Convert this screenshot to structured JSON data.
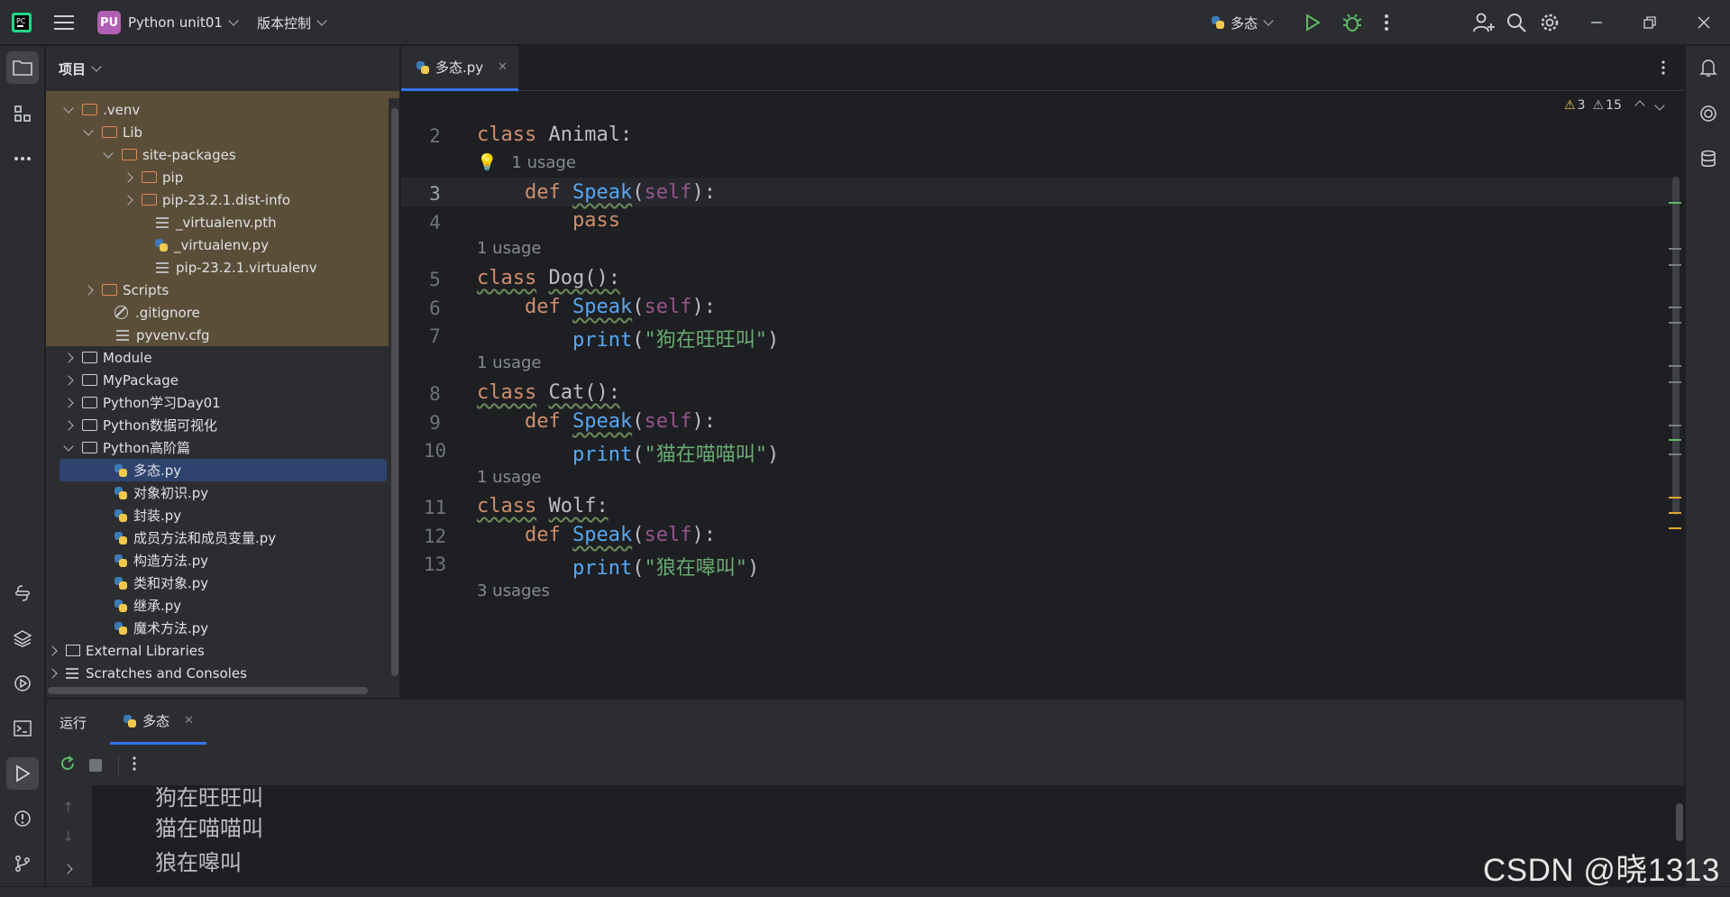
{
  "titlebar": {
    "project_badge": "PU",
    "project_name": "Python unit01",
    "vcs_label": "版本控制",
    "run_config": "多态"
  },
  "project_panel": {
    "title": "项目",
    "tree": [
      {
        "label": ".venv",
        "type": "folder-excluded",
        "state": "expanded"
      },
      {
        "label": "Lib",
        "type": "folder-excluded",
        "state": "expanded"
      },
      {
        "label": "site-packages",
        "type": "folder-excluded",
        "state": "expanded"
      },
      {
        "label": "pip",
        "type": "folder-excluded",
        "state": "collapsed"
      },
      {
        "label": "pip-23.2.1.dist-info",
        "type": "folder-excluded",
        "state": "collapsed"
      },
      {
        "label": "_virtualenv.pth",
        "type": "text"
      },
      {
        "label": "_virtualenv.py",
        "type": "python"
      },
      {
        "label": "pip-23.2.1.virtualenv",
        "type": "text"
      },
      {
        "label": "Scripts",
        "type": "folder-excluded",
        "state": "collapsed"
      },
      {
        "label": ".gitignore",
        "type": "ignore"
      },
      {
        "label": "pyvenv.cfg",
        "type": "text"
      },
      {
        "label": "Module",
        "type": "folder",
        "state": "collapsed"
      },
      {
        "label": "MyPackage",
        "type": "package",
        "state": "collapsed"
      },
      {
        "label": "Python学习Day01",
        "type": "folder",
        "state": "collapsed"
      },
      {
        "label": "Python数据可视化",
        "type": "folder",
        "state": "collapsed"
      },
      {
        "label": "Python高阶篇",
        "type": "folder",
        "state": "expanded"
      },
      {
        "label": "多态.py",
        "type": "python",
        "selected": true
      },
      {
        "label": "对象初识.py",
        "type": "python"
      },
      {
        "label": "封装.py",
        "type": "python"
      },
      {
        "label": "成员方法和成员变量.py",
        "type": "python"
      },
      {
        "label": "构造方法.py",
        "type": "python"
      },
      {
        "label": "类和对象.py",
        "type": "python"
      },
      {
        "label": "继承.py",
        "type": "python"
      },
      {
        "label": "魔术方法.py",
        "type": "python"
      },
      {
        "label": "External Libraries",
        "type": "library",
        "state": "collapsed"
      },
      {
        "label": "Scratches and Consoles",
        "type": "scratches",
        "state": "collapsed"
      }
    ]
  },
  "editor": {
    "tab_label": "多态.py",
    "warnings_a": "3",
    "warnings_b": "15",
    "line_numbers": [
      "2",
      "3",
      "4",
      "5",
      "6",
      "7",
      "8",
      "9",
      "10",
      "11",
      "12",
      "13"
    ],
    "hints": {
      "animal_usage": "1 usage",
      "dog_usage": "1 usage",
      "cat_usage": "1 usage",
      "wolf_usage": "1 usage",
      "func_usage": "3 usages"
    },
    "code": {
      "l2_kw": "class",
      "l2_name": "Animal:",
      "def": "def",
      "speak": "Speak",
      "self": "self",
      "pass": "pass",
      "print": "print",
      "l5_name": "Dog():",
      "l7_str": "\"狗在旺旺叫\"",
      "l8_name": "Cat():",
      "l10_str": "\"猫在喵喵叫\"",
      "l11_name": "Wolf:",
      "l13_str": "\"狼在嗥叫\""
    }
  },
  "run_panel": {
    "title": "运行",
    "tab_label": "多态",
    "output": [
      "狗在旺旺叫",
      "猫在喵喵叫",
      "狼在嗥叫"
    ]
  },
  "watermark": "CSDN @晓1313",
  "colors": {
    "accent": "#3574f0",
    "keyword": "#cf8e6d",
    "function": "#56a8f5",
    "string": "#6aab73",
    "self": "#94558d"
  }
}
